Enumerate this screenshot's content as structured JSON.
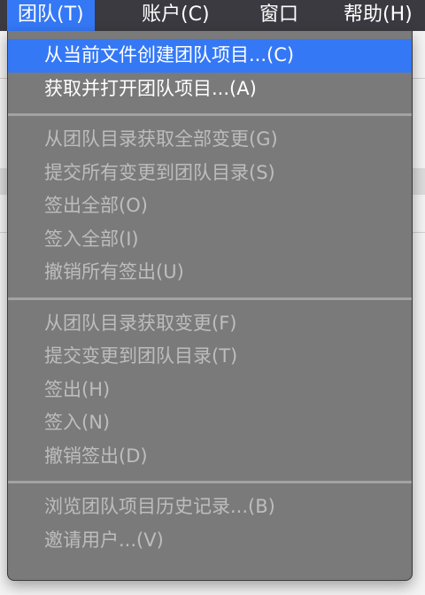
{
  "menubar": {
    "items": [
      "团队(T)",
      "账户(C)",
      "窗口",
      "帮助(H)"
    ],
    "active": 0
  },
  "menu": {
    "groups": [
      [
        {
          "label": "从当前文件创建团队项目...(C)",
          "enabled": true,
          "highlighted": true
        },
        {
          "label": "获取并打开团队项目...(A)",
          "enabled": true
        }
      ],
      [
        {
          "label": "从团队目录获取全部变更(G)",
          "enabled": false
        },
        {
          "label": "提交所有变更到团队目录(S)",
          "enabled": false
        },
        {
          "label": "签出全部(O)",
          "enabled": false
        },
        {
          "label": "签入全部(I)",
          "enabled": false
        },
        {
          "label": "撤销所有签出(U)",
          "enabled": false
        }
      ],
      [
        {
          "label": "从团队目录获取变更(F)",
          "enabled": false
        },
        {
          "label": "提交变更到团队目录(T)",
          "enabled": false
        },
        {
          "label": "签出(H)",
          "enabled": false
        },
        {
          "label": "签入(N)",
          "enabled": false
        },
        {
          "label": "撤销签出(D)",
          "enabled": false
        }
      ],
      [
        {
          "label": "浏览团队项目历史记录...(B)",
          "enabled": false
        },
        {
          "label": "邀请用户...(V)",
          "enabled": false
        }
      ]
    ]
  },
  "colors": {
    "highlight": "#3478f6",
    "menubar": "#3b3a40",
    "menu_bg": "#7a7a7a"
  }
}
